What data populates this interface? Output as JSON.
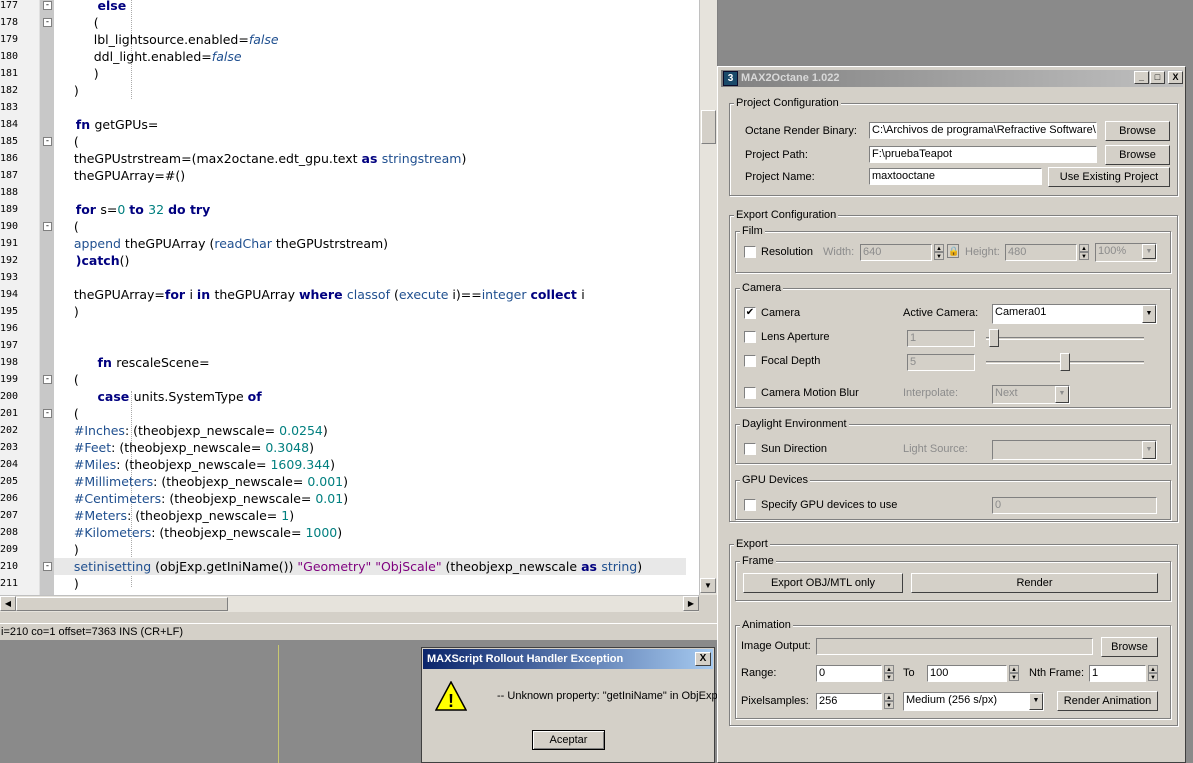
{
  "editor": {
    "lines": [
      {
        "n": "177",
        "t": [
          [
            "k",
            "          else"
          ]
        ]
      },
      {
        "n": "178",
        "t": [
          [
            "",
            "          ("
          ]
        ]
      },
      {
        "n": "179",
        "t": [
          [
            "",
            "          lbl_lightsource.enabled="
          ],
          [
            "i",
            "false"
          ]
        ]
      },
      {
        "n": "180",
        "t": [
          [
            "",
            "          ddl_light.enabled="
          ],
          [
            "i",
            "false"
          ]
        ]
      },
      {
        "n": "181",
        "t": [
          [
            "",
            "          )"
          ]
        ]
      },
      {
        "n": "182",
        "t": [
          [
            "",
            "     )"
          ]
        ]
      },
      {
        "n": "183",
        "t": [
          [
            "",
            ""
          ]
        ]
      },
      {
        "n": "184",
        "t": [
          [
            "k",
            "     fn "
          ],
          [
            "",
            "getGPUs="
          ]
        ]
      },
      {
        "n": "185",
        "t": [
          [
            "",
            "     ("
          ]
        ]
      },
      {
        "n": "186",
        "t": [
          [
            "",
            "     theGPUstrstream=(max2octane.edt_gpu.text "
          ],
          [
            "k",
            "as "
          ],
          [
            "f",
            "stringstream"
          ],
          [
            "",
            ")"
          ]
        ]
      },
      {
        "n": "187",
        "t": [
          [
            "",
            "     theGPUArray=#()"
          ]
        ]
      },
      {
        "n": "188",
        "t": [
          [
            "",
            ""
          ]
        ]
      },
      {
        "n": "189",
        "t": [
          [
            "k",
            "     for "
          ],
          [
            "",
            "s="
          ],
          [
            "n",
            "0 "
          ],
          [
            "k",
            "to "
          ],
          [
            "n",
            "32 "
          ],
          [
            "k",
            "do try"
          ]
        ]
      },
      {
        "n": "190",
        "t": [
          [
            "",
            "     ("
          ]
        ]
      },
      {
        "n": "191",
        "t": [
          [
            "f",
            "     append "
          ],
          [
            "",
            "theGPUArray ("
          ],
          [
            "f",
            "readChar "
          ],
          [
            "",
            "theGPUstrstream)"
          ]
        ]
      },
      {
        "n": "192",
        "t": [
          [
            "k",
            "     )catch"
          ],
          [
            "",
            "()"
          ]
        ]
      },
      {
        "n": "193",
        "t": [
          [
            "",
            ""
          ]
        ]
      },
      {
        "n": "194",
        "t": [
          [
            "",
            "     theGPUArray="
          ],
          [
            "k",
            "for "
          ],
          [
            "",
            "i "
          ],
          [
            "k",
            "in "
          ],
          [
            "",
            "theGPUArray "
          ],
          [
            "k",
            "where "
          ],
          [
            "f",
            "classof "
          ],
          [
            "",
            "("
          ],
          [
            "f",
            "execute "
          ],
          [
            "",
            "i)=="
          ],
          [
            "f",
            "integer "
          ],
          [
            "k",
            "collect "
          ],
          [
            "",
            "i"
          ]
        ]
      },
      {
        "n": "195",
        "t": [
          [
            "",
            "     )"
          ]
        ]
      },
      {
        "n": "196",
        "t": [
          [
            "",
            ""
          ]
        ]
      },
      {
        "n": "197",
        "t": [
          [
            "",
            ""
          ]
        ]
      },
      {
        "n": "198",
        "t": [
          [
            "k",
            "          fn "
          ],
          [
            "",
            "rescaleScene="
          ]
        ]
      },
      {
        "n": "199",
        "t": [
          [
            "",
            "     ("
          ]
        ]
      },
      {
        "n": "200",
        "t": [
          [
            "k",
            "          case "
          ],
          [
            "",
            "units.SystemType "
          ],
          [
            "k",
            "of"
          ]
        ]
      },
      {
        "n": "201",
        "t": [
          [
            "",
            "     ("
          ]
        ]
      },
      {
        "n": "202",
        "t": [
          [
            "f",
            "     #Inches"
          ],
          [
            "",
            ": (theobjexp_newscale= "
          ],
          [
            "n",
            "0.0254"
          ],
          [
            "",
            ")"
          ]
        ]
      },
      {
        "n": "203",
        "t": [
          [
            "f",
            "     #Feet"
          ],
          [
            "",
            ": (theobjexp_newscale= "
          ],
          [
            "n",
            "0.3048"
          ],
          [
            "",
            ")"
          ]
        ]
      },
      {
        "n": "204",
        "t": [
          [
            "f",
            "     #Miles"
          ],
          [
            "",
            ": (theobjexp_newscale= "
          ],
          [
            "n",
            "1609.344"
          ],
          [
            "",
            ")"
          ]
        ]
      },
      {
        "n": "205",
        "t": [
          [
            "f",
            "     #Millimeters"
          ],
          [
            "",
            ": (theobjexp_newscale= "
          ],
          [
            "n",
            "0.001"
          ],
          [
            "",
            ")"
          ]
        ]
      },
      {
        "n": "206",
        "t": [
          [
            "f",
            "     #Centimeters"
          ],
          [
            "",
            ": (theobjexp_newscale= "
          ],
          [
            "n",
            "0.01"
          ],
          [
            "",
            ")"
          ]
        ]
      },
      {
        "n": "207",
        "t": [
          [
            "f",
            "     #Meters"
          ],
          [
            "",
            ": (theobjexp_newscale= "
          ],
          [
            "n",
            "1"
          ],
          [
            "",
            ")"
          ]
        ]
      },
      {
        "n": "208",
        "t": [
          [
            "f",
            "     #Kilometers"
          ],
          [
            "",
            ": (theobjexp_newscale= "
          ],
          [
            "n",
            "1000"
          ],
          [
            "",
            ")"
          ]
        ]
      },
      {
        "n": "209",
        "t": [
          [
            "",
            "     )"
          ]
        ]
      },
      {
        "n": "210",
        "t": [
          [
            "f",
            "     setinisetting "
          ],
          [
            "",
            "(objExp.getIniName()) "
          ],
          [
            "s",
            "\"Geometry\" \"ObjScale\" "
          ],
          [
            "",
            "(theobjexp_newscale "
          ],
          [
            "k",
            "as "
          ],
          [
            "f",
            "string"
          ],
          [
            "",
            ")"
          ]
        ]
      },
      {
        "n": "211",
        "t": [
          [
            "",
            "     )"
          ]
        ]
      }
    ],
    "fold_markers": [
      "177",
      "178",
      "185",
      "190",
      "199",
      "201",
      "210"
    ],
    "status": "i=210 co=1 offset=7363 INS (CR+LF)",
    "colors": {
      "keyword": "#00007f",
      "function": "#1f4f8f",
      "number": "#007f7f",
      "string": "#7f007f"
    }
  },
  "dialog": {
    "title": "MAXScript Rollout Handler Exception",
    "close": "X",
    "message": "-- Unknown property: \"getIniName\" in ObjExp",
    "ok": "Aceptar",
    "warning_icon": "!"
  },
  "panel": {
    "title": "MAX2Octane 1.022",
    "icon": "3",
    "window_buttons": [
      "_",
      "□",
      "X"
    ],
    "project": {
      "label": "Project Configuration",
      "binary_label": "Octane Render Binary:",
      "binary_value": "C:\\Archivos de programa\\Refractive Software\\",
      "path_label": "Project Path:",
      "path_value": "F:\\pruebaTeapot",
      "name_label": "Project Name:",
      "name_value": "maxtooctane",
      "browse": "Browse",
      "use_existing": "Use Existing Project"
    },
    "export": {
      "label": "Export Configuration",
      "film": {
        "label": "Film",
        "resolution": "Resolution",
        "width_label": "Width:",
        "width": "640",
        "height_label": "Height:",
        "height": "480",
        "percent": "100%"
      },
      "camera": {
        "label": "Camera",
        "camera": "Camera",
        "active_label": "Active Camera:",
        "active": "Camera01",
        "lens": "Lens Aperture",
        "lens_value": "1",
        "lens_slider": 0.02,
        "focal": "Focal Depth",
        "focal_value": "5",
        "focal_slider": 0.5,
        "motion_blur": "Camera Motion Blur",
        "interpolate_label": "Interpolate:",
        "interpolate": "Next"
      },
      "daylight": {
        "label": "Daylight Environment",
        "sun": "Sun Direction",
        "light_label": "Light Source:"
      },
      "gpu": {
        "label": "GPU Devices",
        "specify": "Specify GPU devices to use",
        "value": "0"
      }
    },
    "export2": {
      "label": "Export",
      "frame_label": "Frame",
      "export_obj": "Export OBJ/MTL only",
      "render": "Render",
      "animation_label": "Animation",
      "image_output": "Image Output:",
      "browse": "Browse",
      "range_label": "Range:",
      "range_from": "0",
      "to_label": "To",
      "range_to": "100",
      "nth_label": "Nth Frame:",
      "nth": "1",
      "pixelsamples_label": "Pixelsamples:",
      "pixelsamples": "256",
      "quality": "Medium (256 s/px)",
      "render_animation": "Render Animation"
    }
  }
}
